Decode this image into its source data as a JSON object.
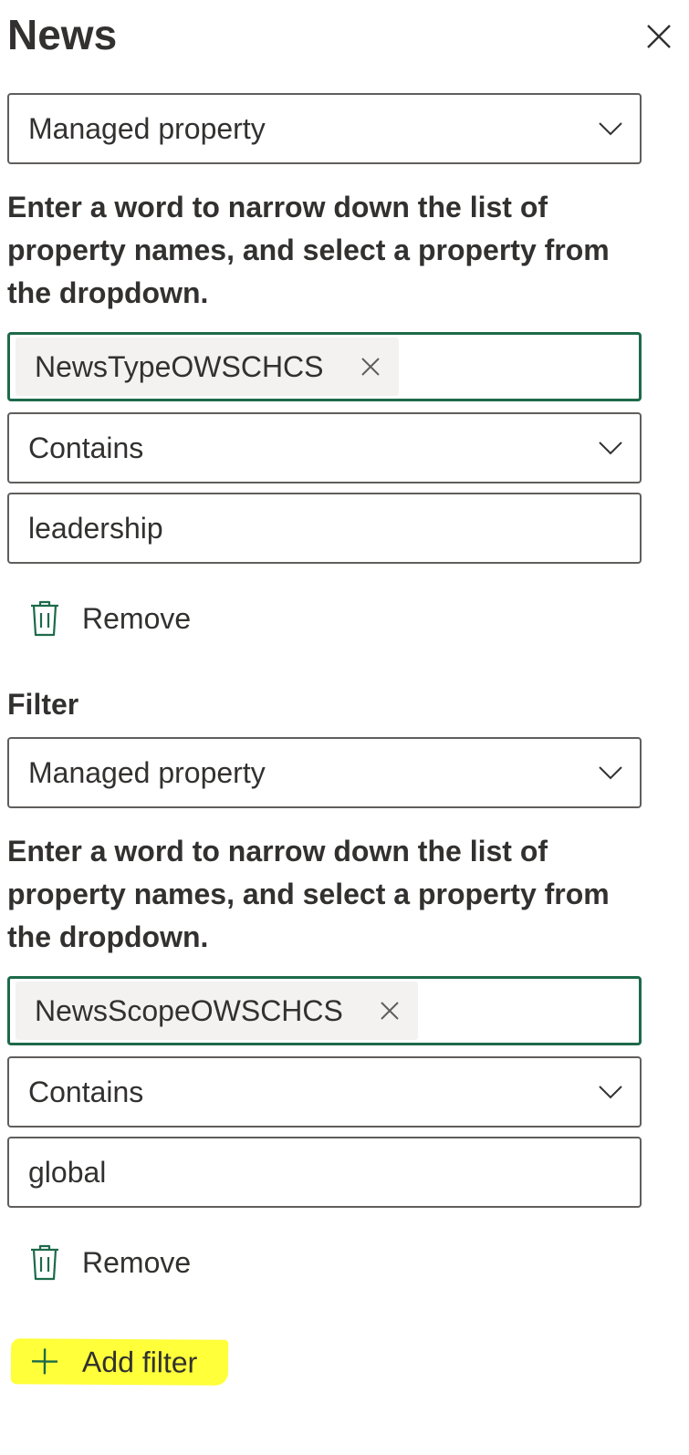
{
  "panel": {
    "title": "News"
  },
  "filters": [
    {
      "section_label": "",
      "type_select_value": "Managed property",
      "hint": "Enter a word to narrow down the list of property names, and select a property from the dropdown.",
      "property_chip": "NewsTypeOWSCHCS",
      "operator_select_value": "Contains",
      "value": "leadership",
      "remove_label": "Remove"
    },
    {
      "section_label": "Filter",
      "type_select_value": "Managed property",
      "hint": "Enter a word to narrow down the list of property names, and select a property from the dropdown.",
      "property_chip": "NewsScopeOWSCHCS",
      "operator_select_value": "Contains",
      "value": "global",
      "remove_label": "Remove"
    }
  ],
  "actions": {
    "add_filter_label": "Add filter"
  },
  "colors": {
    "accent_green": "#1d6a4a",
    "highlight_yellow": "#ffff3a",
    "text": "#323130"
  },
  "icons": [
    "close-icon",
    "chevron-down-icon",
    "chip-remove-icon",
    "trash-icon",
    "plus-icon"
  ]
}
